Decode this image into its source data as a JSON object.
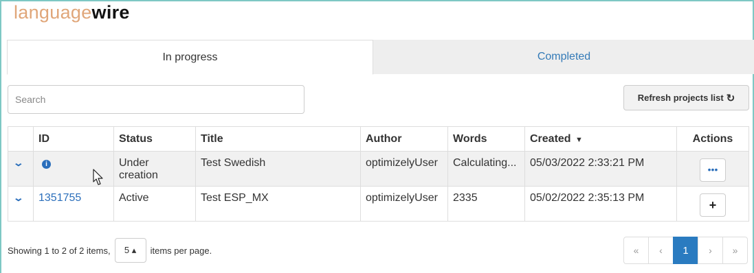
{
  "logo": {
    "part1": "language",
    "part2": "wire"
  },
  "tabs": [
    {
      "label": "In progress",
      "active": true
    },
    {
      "label": "Completed",
      "active": false
    }
  ],
  "search": {
    "placeholder": "Search",
    "value": ""
  },
  "refresh_button": {
    "label": "Refresh projects list",
    "icon": "refresh-icon"
  },
  "table": {
    "columns": [
      "",
      "ID",
      "Status",
      "Title",
      "Author",
      "Words",
      "Created",
      "Actions"
    ],
    "sort": {
      "column": "Created",
      "direction": "desc"
    },
    "rows": [
      {
        "id": "",
        "id_icon": "info-icon",
        "status": "Under creation",
        "title": "Test Swedish",
        "author": "optimizelyUser",
        "words": "Calculating...",
        "created": "05/03/2022 2:33:21 PM",
        "action": "•••",
        "action_icon": "ellipsis-icon"
      },
      {
        "id": "1351755",
        "id_icon": "",
        "status": "Active",
        "title": "Test ESP_MX",
        "author": "optimizelyUser",
        "words": "2335",
        "created": "05/02/2022 2:35:13 PM",
        "action": "+",
        "action_icon": "plus-icon"
      }
    ]
  },
  "footer": {
    "showing_text": "Showing 1 to 2 of 2 items,",
    "per_page_value": "5 ▴",
    "per_page_suffix": "items per page."
  },
  "pagination": {
    "first": "«",
    "prev": "‹",
    "current": "1",
    "next": "›",
    "last": "»"
  },
  "colors": {
    "accent": "#2a7bc0",
    "logo_light": "#e0a679",
    "frame": "#7ec8c4"
  }
}
